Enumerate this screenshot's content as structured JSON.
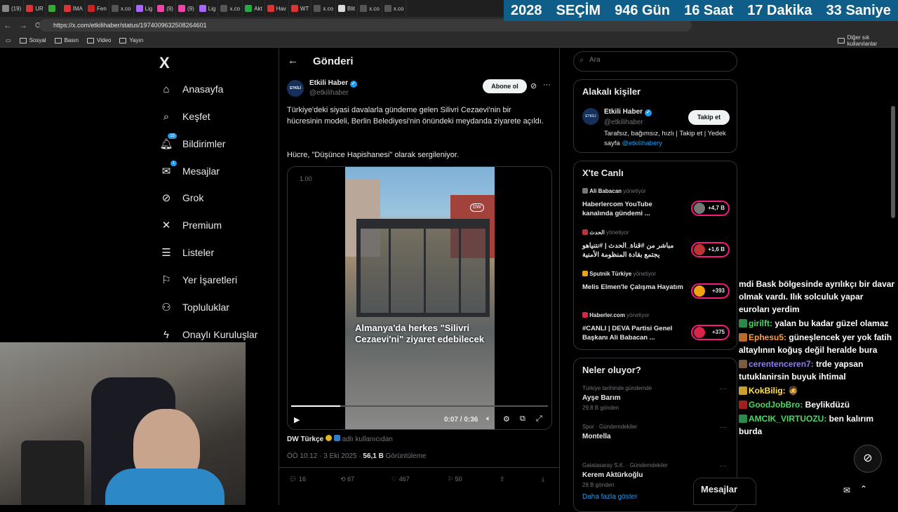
{
  "browser": {
    "tabs": [
      "(19)",
      "UR",
      "",
      "İMA",
      "Fen",
      "x.co",
      "Lig",
      "(9)",
      "(9)",
      "Lig",
      "x.co",
      "Akt",
      "Hav",
      "WT",
      "x.co",
      "Blit",
      "x.co",
      "x.co"
    ],
    "url": "https://x.com/etkilihaber/status/1974009632508264601",
    "bookmarks": [
      "Sosyal",
      "Basın",
      "Video",
      "Yayın"
    ],
    "other_bookmarks": "Diğer sık kullanılanlar"
  },
  "countdown": {
    "year": "2028",
    "label": "SEÇİM",
    "days": "946 Gün",
    "hours": "16 Saat",
    "minutes": "17 Dakika",
    "seconds": "33 Saniye",
    "color": "#0f5e8a"
  },
  "nav": {
    "logo": "X",
    "items": [
      {
        "label": "Anasayfa",
        "icon": "home-icon"
      },
      {
        "label": "Keşfet",
        "icon": "search-icon"
      },
      {
        "label": "Bildirimler",
        "icon": "bell-icon",
        "badge": "15"
      },
      {
        "label": "Mesajlar",
        "icon": "mail-icon",
        "badge": "1"
      },
      {
        "label": "Grok",
        "icon": "grok-icon"
      },
      {
        "label": "Premium",
        "icon": "x-icon"
      },
      {
        "label": "Listeler",
        "icon": "list-icon"
      },
      {
        "label": "Yer İşaretleri",
        "icon": "bookmark-icon"
      },
      {
        "label": "Topluluklar",
        "icon": "people-icon"
      },
      {
        "label": "Onaylı Kuruluşlar",
        "icon": "bolt-icon"
      }
    ]
  },
  "post": {
    "header_title": "Gönderi",
    "author_name": "Etkili Haber",
    "author_handle": "@etkilihaber",
    "subscribe": "Abone ol",
    "text1": "Türkiye'deki siyasi davalarla gündeme gelen Silivri Cezaevi'nin bir hücresinin modeli, Berlin Belediyesi'nin önündeki meydanda ziyarete açıldı.",
    "text2": "Hücre, \"Düşünce Hapishanesi\" olarak sergileniyor.",
    "video_rate": "1.00",
    "video_caption": "Almanya'da herkes \"Silivri Cezaevi'ni\" ziyaret edebilecek",
    "video_time": "0:07 / 0:36",
    "video_progress": 0.19,
    "source_name": "DW Türkçe",
    "source_suffix": "adlı kullanıcıdan",
    "time": "ÖÖ 10:12 · 3 Eki 2025 ·",
    "views": "56,1 B",
    "views_label": "Görüntüleme",
    "stats": {
      "replies": "16",
      "reposts": "67",
      "likes": "467",
      "bookmarks": "50"
    }
  },
  "search": {
    "placeholder": "Ara"
  },
  "related": {
    "title": "Alakalı kişiler",
    "name": "Etkili Haber",
    "handle": "@etkilihaber",
    "follow": "Takip et",
    "bio_text": "Tarafsız, bağımsız, hızlı | Takip et | Yedek sayfa",
    "bio_link": "@etkilihabery"
  },
  "live": {
    "title": "X'te Canlı",
    "items": [
      {
        "host": "Ali Babacan",
        "role": "yönetiyor",
        "text": "Haberlercom YouTube kanalında gündemi ...",
        "count": "+4,7 B"
      },
      {
        "host": "الحدث",
        "role": "yönetiyor",
        "text": "مباشر من #قناة_الحدث | #نتنياهو يجتمع بقادة المنظومة الأمنية",
        "count": "+1,6 B"
      },
      {
        "host": "Sputnik Türkiye",
        "role": "yönetiyor",
        "text": "Melis Elmen'le Çalışma Hayatım",
        "count": "+393"
      },
      {
        "host": "Haberler.com",
        "role": "yönetiyor",
        "text": "#CANLI | DEVA Partisi Genel Başkanı Ali Babacan ...",
        "count": "+375"
      }
    ]
  },
  "trends": {
    "title": "Neler oluyor?",
    "items": [
      {
        "context": "Türkiye tarihinde gündemde",
        "name": "Ayşe Barım",
        "count": "29,8 B gönderi"
      },
      {
        "context": "Spor · Gündemdekiler",
        "name": "Montella",
        "count": ""
      },
      {
        "context": "Galatasaray S.K. · Gündemdekiler",
        "name": "Kerem Aktürkoğlu",
        "count": "28 B gönderi"
      }
    ],
    "more": "Daha fazla göster"
  },
  "messages_drawer": "Mesajlar",
  "chat": [
    {
      "user": "",
      "color": "#ffffff",
      "text": "mdi Bask bölgesinde ayrılıkçı bir davar olmak vardı. Ilık solculuk yapar euroları yerdim"
    },
    {
      "user": "girilft:",
      "color": "#4cd964",
      "text": "yalan bu kadar güzel olamaz"
    },
    {
      "user": "Ephesu5:",
      "color": "#ff9f43",
      "text": "güneşlencek yer yok fatih altaylının koğuş değil heralde bura"
    },
    {
      "user": "cerentenceren7:",
      "color": "#8f7bff",
      "text": "trde yapsan tutuklanirsin buyuk ihtimal"
    },
    {
      "user": "KokBilig:",
      "color": "#ffe14d",
      "text": "🧔"
    },
    {
      "user": "GoodJobBro:",
      "color": "#4cd964",
      "text": "Beylikdüzü"
    },
    {
      "user": "AMCIK_VIRTUOZU:",
      "color": "#4cd964",
      "text": "ben kalırım burda"
    }
  ]
}
